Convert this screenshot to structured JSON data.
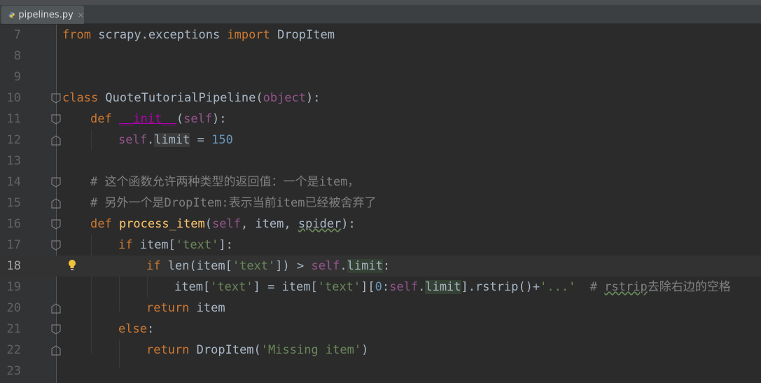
{
  "tab": {
    "filename": "pipelines.py",
    "close_glyph": "×"
  },
  "lines": [
    {
      "num": "7"
    },
    {
      "num": "8"
    },
    {
      "num": "9"
    },
    {
      "num": "10"
    },
    {
      "num": "11"
    },
    {
      "num": "12"
    },
    {
      "num": "13"
    },
    {
      "num": "14"
    },
    {
      "num": "15"
    },
    {
      "num": "16"
    },
    {
      "num": "17"
    },
    {
      "num": "18"
    },
    {
      "num": "19"
    },
    {
      "num": "20"
    },
    {
      "num": "21"
    },
    {
      "num": "22"
    },
    {
      "num": "23"
    }
  ],
  "code": {
    "l7": {
      "kw1": "from",
      "mod": " scrapy.exceptions ",
      "kw2": "import",
      "name": " DropItem"
    },
    "l10": {
      "kw": "class",
      "name": " QuoteTutorialPipeline(",
      "base": "object",
      "end": "):"
    },
    "l11": {
      "kw": "def ",
      "dunder": "__init__",
      "p1": "(",
      "self": "self",
      "p2": "):"
    },
    "l12": {
      "self": "self",
      "dot": ".",
      "attr": "limit",
      "eq": " = ",
      "num": "150"
    },
    "l14": {
      "comment": "# 这个函数允许两种类型的返回值：一个是item，"
    },
    "l15": {
      "comment": "# 另外一个是DropItem:表示当前item已经被舍弃了"
    },
    "l16": {
      "kw": "def ",
      "fn": "process_item",
      "p1": "(",
      "self": "self",
      "p2": ", item, ",
      "spider": "spider",
      "p3": "):"
    },
    "l17": {
      "kw": "if",
      "t1": " item[",
      "str": "'text'",
      "t2": "]:"
    },
    "l18": {
      "kw": "if",
      "t1": " len(item[",
      "str": "'text'",
      "t2": "]) > ",
      "self": "self",
      "dot": ".",
      "attr": "limit",
      "t3": ":"
    },
    "l19": {
      "t1": "item[",
      "s1": "'text'",
      "t2": "] = item[",
      "s2": "'text'",
      "t3": "][",
      "n0": "0",
      "colon": ":",
      "self": "self",
      "dot": ".",
      "attr": "limit",
      "t4": "].rstrip()+",
      "s3": "'...'",
      "gap": "  ",
      "c1": "# ",
      "c2": "rstrip",
      "c3": "去除右边的空格"
    },
    "l20": {
      "kw": "return",
      "t": " item"
    },
    "l21": {
      "kw": "else",
      "t": ":"
    },
    "l22": {
      "kw": "return",
      "t1": " DropItem(",
      "str": "'Missing item'",
      "t2": ")"
    }
  },
  "colors": {
    "background": "#2b2b2b",
    "keyword": "#cc7832",
    "function": "#ffc66d",
    "string": "#6a8759",
    "comment": "#808080",
    "self": "#94558d",
    "number": "#6897bb"
  },
  "icons": {
    "file": "python-file-icon",
    "intention": "lightbulb-icon",
    "fold": "fold-marker-icon"
  }
}
